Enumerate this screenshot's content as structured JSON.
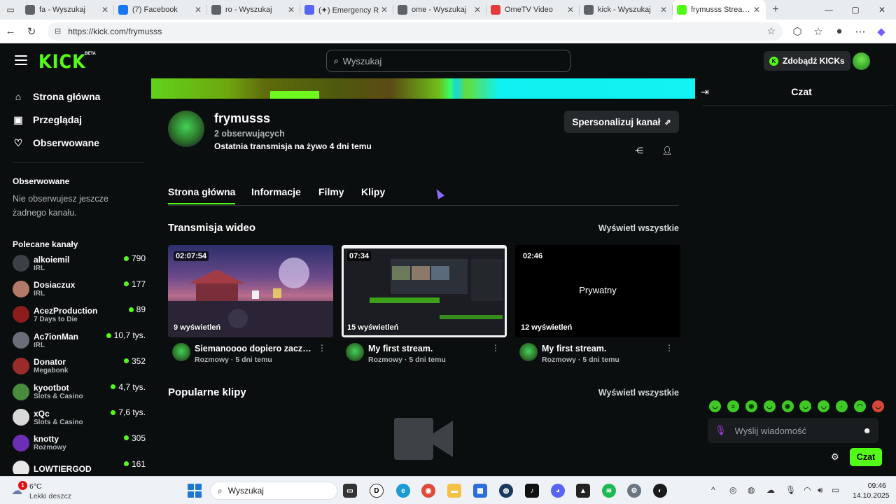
{
  "browser": {
    "tabs": [
      {
        "label": "fa - Wyszukaj",
        "favicon": "search-icon",
        "color": "#5f6368"
      },
      {
        "label": "(7) Facebook",
        "favicon": "facebook-icon",
        "color": "#1877f2"
      },
      {
        "label": "ro - Wyszukaj",
        "favicon": "search-icon",
        "color": "#5f6368"
      },
      {
        "label": "(✦) Emergency R",
        "favicon": "discord-icon",
        "color": "#5865f2"
      },
      {
        "label": "ome - Wyszukaj",
        "favicon": "search-icon",
        "color": "#5f6368"
      },
      {
        "label": "OmeTV Video",
        "favicon": "ometv-icon",
        "color": "#e43b3b"
      },
      {
        "label": "kick - Wyszukaj",
        "favicon": "search-icon",
        "color": "#5f6368"
      },
      {
        "label": "frymusss Stream -",
        "favicon": "kick-icon",
        "color": "#53fc18"
      }
    ],
    "url": "https://kick.com/frymusss"
  },
  "header": {
    "logo": "KICK",
    "beta": "BETA",
    "search_placeholder": "Wyszukaj",
    "kicks_button": "Zdobądź KICKs"
  },
  "sidebar": {
    "nav": [
      {
        "label": "Strona główna",
        "icon": "home-icon"
      },
      {
        "label": "Przeglądaj",
        "icon": "browse-icon"
      },
      {
        "label": "Obserwowane",
        "icon": "heart-icon"
      }
    ],
    "following_title": "Obserwowane",
    "following_empty": "Nie obserwujesz jeszcze żadnego kanału.",
    "recommended_title": "Polecane kanały",
    "channels": [
      {
        "name": "alkoiemil",
        "category": "IRL",
        "viewers": "790",
        "color": "#3c3f43"
      },
      {
        "name": "Dosiaczux",
        "category": "IRL",
        "viewers": "177",
        "color": "#b37a6a"
      },
      {
        "name": "AcezProduction",
        "category": "7 Days to Die",
        "viewers": "89",
        "color": "#8b1d1d"
      },
      {
        "name": "Ac7ionMan",
        "category": "IRL",
        "viewers": "10,7 tys.",
        "color": "#6b6e78"
      },
      {
        "name": "Donator",
        "category": "Megabonk",
        "viewers": "352",
        "color": "#9a2b2b"
      },
      {
        "name": "kyootbot",
        "category": "Slots & Casino",
        "viewers": "4,7 tys.",
        "color": "#4a8a3e"
      },
      {
        "name": "xQc",
        "category": "Slots & Casino",
        "viewers": "7,6 tys.",
        "color": "#d9d9d9"
      },
      {
        "name": "knotty",
        "category": "Rozmowy",
        "viewers": "305",
        "color": "#6b2fb3"
      },
      {
        "name": "LOWTIERGOD",
        "category": "",
        "viewers": "161",
        "color": "#e8e8e8"
      }
    ]
  },
  "channel": {
    "name": "frymusss",
    "followers": "2 obserwujących",
    "last_stream": "Ostatnia transmisja na żywo 4 dni temu",
    "customize_button": "Spersonalizuj kanał",
    "tabs": [
      "Strona główna",
      "Informacje",
      "Filmy",
      "Klipy"
    ]
  },
  "videos_section": {
    "title": "Transmisja wideo",
    "see_all": "Wyświetl wszystkie",
    "videos": [
      {
        "duration": "02:07:54",
        "views": "9 wyświetleń",
        "title": "Siemanoooo dopiero zaczy...",
        "sub": "Rozmowy · 5 dni temu",
        "private": ""
      },
      {
        "duration": "07:34",
        "views": "15 wyświetleń",
        "title": "My first stream.",
        "sub": "Rozmowy · 5 dni temu",
        "private": ""
      },
      {
        "duration": "02:46",
        "views": "12 wyświetleń",
        "title": "My first stream.",
        "sub": "Rozmowy · 5 dni temu",
        "private": "Prywatny"
      }
    ]
  },
  "clips_section": {
    "title": "Popularne klipy",
    "see_all": "Wyświetl wszystkie"
  },
  "chat": {
    "title": "Czat",
    "placeholder": "Wyślij wiadomość",
    "send_button": "Czat"
  },
  "taskbar": {
    "temperature": "6°C",
    "weather": "Lekki deszcz",
    "weather_badge": "1",
    "search": "Wyszukaj",
    "time": "09:46",
    "date": "14.10.2025"
  }
}
